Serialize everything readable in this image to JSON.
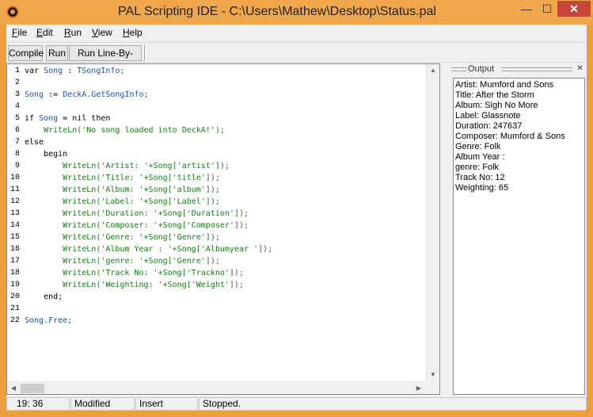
{
  "window": {
    "title": "PAL Scripting IDE - C:\\Users\\Mathew\\Desktop\\Status.pal",
    "min_glyph": "—",
    "max_glyph": "☐",
    "close_glyph": "✕"
  },
  "menu": {
    "file": {
      "ul": "F",
      "rest": "ile"
    },
    "edit": {
      "ul": "E",
      "rest": "dit"
    },
    "run": {
      "ul": "R",
      "rest": "un"
    },
    "view": {
      "ul": "V",
      "rest": "iew"
    },
    "help": {
      "ul": "H",
      "rest": "elp"
    }
  },
  "toolbar": {
    "compile": "Compile",
    "run": "Run",
    "run_line": "Run Line-By-Line"
  },
  "editor": {
    "line_numbers": [
      "1",
      "2",
      "3",
      "4",
      "5",
      "6",
      "7",
      "8",
      "9",
      "10",
      "11",
      "12",
      "13",
      "14",
      "15",
      "16",
      "17",
      "18",
      "19",
      "20",
      "21",
      "22"
    ],
    "lines": [
      [
        {
          "t": "var ",
          "c": "kw"
        },
        {
          "t": "Song",
          "c": "ident"
        },
        {
          "t": " : ",
          "c": "kw"
        },
        {
          "t": "TSongInfo;",
          "c": "ident"
        }
      ],
      [],
      [
        {
          "t": "Song",
          "c": "ident"
        },
        {
          "t": " := ",
          "c": "kw"
        },
        {
          "t": "DeckA.GetSongInfo;",
          "c": "ident"
        }
      ],
      [],
      [
        {
          "t": "if ",
          "c": "kw"
        },
        {
          "t": "Song",
          "c": "ident"
        },
        {
          "t": " = nil then",
          "c": "kw"
        }
      ],
      [
        {
          "t": "    ",
          "c": "kw"
        },
        {
          "t": "WriteLn(",
          "c": "str"
        },
        {
          "t": "'No song loaded into DeckA!'",
          "c": "str"
        },
        {
          "t": ");",
          "c": "str"
        }
      ],
      [
        {
          "t": "else",
          "c": "kw"
        }
      ],
      [
        {
          "t": "    begin",
          "c": "kw"
        }
      ],
      [
        {
          "t": "        ",
          "c": "kw"
        },
        {
          "t": "WriteLn(",
          "c": "str"
        },
        {
          "t": "'Artist: '",
          "c": "str"
        },
        {
          "t": "+Song['artist']);",
          "c": "str"
        }
      ],
      [
        {
          "t": "        ",
          "c": "kw"
        },
        {
          "t": "WriteLn(",
          "c": "str"
        },
        {
          "t": "'Title: '",
          "c": "str"
        },
        {
          "t": "+Song['title']);",
          "c": "str"
        }
      ],
      [
        {
          "t": "        ",
          "c": "kw"
        },
        {
          "t": "WriteLn(",
          "c": "str"
        },
        {
          "t": "'Album: '",
          "c": "str"
        },
        {
          "t": "+Song['album']);",
          "c": "str"
        }
      ],
      [
        {
          "t": "        ",
          "c": "kw"
        },
        {
          "t": "WriteLn(",
          "c": "str"
        },
        {
          "t": "'Label: '",
          "c": "str"
        },
        {
          "t": "+Song['Label']);",
          "c": "str"
        }
      ],
      [
        {
          "t": "        ",
          "c": "kw"
        },
        {
          "t": "WriteLn(",
          "c": "str"
        },
        {
          "t": "'Duration: '",
          "c": "str"
        },
        {
          "t": "+Song['Duration']);",
          "c": "str"
        }
      ],
      [
        {
          "t": "        ",
          "c": "kw"
        },
        {
          "t": "WriteLn(",
          "c": "str"
        },
        {
          "t": "'Composer: '",
          "c": "str"
        },
        {
          "t": "+Song['Composer']);",
          "c": "str"
        }
      ],
      [
        {
          "t": "        ",
          "c": "kw"
        },
        {
          "t": "WriteLn(",
          "c": "str"
        },
        {
          "t": "'Genre: '",
          "c": "str"
        },
        {
          "t": "+Song['Genre']);",
          "c": "str"
        }
      ],
      [
        {
          "t": "        ",
          "c": "kw"
        },
        {
          "t": "WriteLn(",
          "c": "str"
        },
        {
          "t": "'Album Year : '",
          "c": "str"
        },
        {
          "t": "+Song['Albumyear ']);",
          "c": "str"
        }
      ],
      [
        {
          "t": "        ",
          "c": "kw"
        },
        {
          "t": "WriteLn(",
          "c": "str"
        },
        {
          "t": "'genre: '",
          "c": "str"
        },
        {
          "t": "+Song['Genre']);",
          "c": "str"
        }
      ],
      [
        {
          "t": "        ",
          "c": "kw"
        },
        {
          "t": "WriteLn(",
          "c": "str"
        },
        {
          "t": "'Track No: '",
          "c": "str"
        },
        {
          "t": "+Song['Trackno']);",
          "c": "str"
        }
      ],
      [
        {
          "t": "        ",
          "c": "kw"
        },
        {
          "t": "WriteLn(",
          "c": "str"
        },
        {
          "t": "'Weighting: '",
          "c": "str"
        },
        {
          "t": "+Song['Weight']);",
          "c": "str"
        }
      ],
      [
        {
          "t": "    end;",
          "c": "kw"
        }
      ],
      [],
      [
        {
          "t": "Song.Free;",
          "c": "ident"
        }
      ]
    ]
  },
  "output": {
    "title": "Output",
    "close_glyph": "✕",
    "lines": [
      "Artist: Mumford and Sons",
      "Title: After the Storm",
      "Album: Sigh No More",
      "Label: Glassnote",
      "Duration: 247637",
      "Composer: Mumford & Sons",
      "Genre: Folk",
      "Album Year :",
      "genre: Folk",
      "Track No: 12",
      "Weighting: 65"
    ]
  },
  "status": {
    "position": "19: 36",
    "modified": "Modified",
    "mode": "Insert",
    "state": "Stopped."
  },
  "scroll": {
    "up": "▲",
    "down": "▼",
    "left": "◀",
    "right": "▶"
  }
}
